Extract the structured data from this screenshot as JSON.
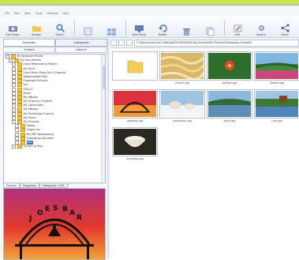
{
  "menu": [
    "File",
    "Edit",
    "View",
    "Tools",
    "Window",
    "Help"
  ],
  "toolbar": [
    {
      "label": "Get Photos",
      "icon": "camera-icon"
    },
    {
      "label": "Browse",
      "icon": "folder-icon"
    },
    {
      "label": "Search",
      "icon": "search-icon"
    },
    {
      "label": "",
      "icon": "view-icon"
    },
    {
      "label": "",
      "icon": "thumbnail-icon"
    },
    {
      "label": "Slide Show",
      "icon": "slideshow-icon"
    },
    {
      "label": "Rotate",
      "icon": "rotate-icon"
    },
    {
      "label": "",
      "icon": "trash-icon"
    },
    {
      "label": "",
      "icon": "copy-icon"
    },
    {
      "label": "Edit",
      "icon": "edit-icon"
    },
    {
      "label": "Options",
      "icon": "options-icon"
    },
    {
      "label": "Share",
      "icon": "share-icon"
    }
  ],
  "left_tabs": [
    "Favorites",
    "Categories"
  ],
  "left_tabs2": [
    "Folders",
    "Albums"
  ],
  "tree": [
    {
      "label": "My Network Places",
      "indent": 0,
      "sel": false
    },
    {
      "label": "My Documents",
      "indent": 1,
      "sel": false
    },
    {
      "label": "Corel Rebranding Project",
      "indent": 2,
      "sel": false
    },
    {
      "label": "My Stuff",
      "indent": 2,
      "sel": false
    },
    {
      "label": "Corel Paint Shop Pro X Projects",
      "indent": 2,
      "sel": false
    },
    {
      "label": "Downloaded Files",
      "indent": 2,
      "sel": false
    },
    {
      "label": "Exported Pictures",
      "indent": 2,
      "sel": false
    },
    {
      "label": "Fax",
      "indent": 2,
      "sel": false
    },
    {
      "label": "iCELLO",
      "indent": 2,
      "sel": false
    },
    {
      "label": "Music",
      "indent": 2,
      "sel": false
    },
    {
      "label": "My eBooks",
      "indent": 2,
      "sel": false
    },
    {
      "label": "My Graphics Projects",
      "indent": 2,
      "sel": false
    },
    {
      "label": "My Collections",
      "indent": 2,
      "sel": false
    },
    {
      "label": "My eBooks",
      "indent": 2,
      "sel": false
    },
    {
      "label": "My PaintShop Projects",
      "indent": 2,
      "sel": false
    },
    {
      "label": "My Music",
      "indent": 2,
      "sel": false
    },
    {
      "label": "My Pictures",
      "indent": 2,
      "sel": false
    },
    {
      "label": "Adobe",
      "indent": 3,
      "sel": false
    },
    {
      "label": "Single Sel",
      "indent": 3,
      "sel": false
    },
    {
      "label": "My PSP Workspaces",
      "indent": 3,
      "sel": false
    },
    {
      "label": "Photoshop Samples",
      "indent": 3,
      "sel": false
    },
    {
      "label": "xxx",
      "indent": 3,
      "sel": true
    },
    {
      "label": "Picture of files",
      "indent": 2,
      "sel": false
    }
  ],
  "bottom_tabs": [
    "Preview",
    "Properties",
    "Categories / EXIF"
  ],
  "address": "C:\\Documents and Settings\\Eric\\Miller\\My Documents\\My Pictures\\Photoshop Samples",
  "thumbs": [
    {
      "caption": "..",
      "kind": "folder"
    },
    {
      "caption": "chairs1.jpg",
      "kind": "pasta"
    },
    {
      "caption": "balloon.jpg",
      "kind": "green"
    },
    {
      "caption": "flowers.jpg",
      "kind": "landscape"
    },
    {
      "caption": "joesbarn.jpg",
      "kind": "sunset"
    },
    {
      "caption": "polarbears.jpg",
      "kind": "snow"
    },
    {
      "caption": "pond.jpg",
      "kind": "lake"
    },
    {
      "caption": "river.jpg",
      "kind": "river"
    },
    {
      "caption": "christmas.jpg",
      "kind": "bowl"
    }
  ],
  "colors": {
    "accent": "#c8e25a",
    "selection": "#3d73c7"
  }
}
